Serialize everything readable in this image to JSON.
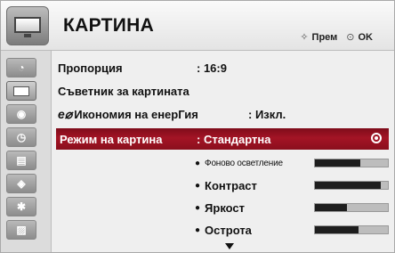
{
  "header": {
    "title": "КАРТИНА",
    "hint_move_icon": "dpad-icon",
    "hint_move": "Прем",
    "hint_ok_icon": "ok-circle-icon",
    "hint_ok": "OK"
  },
  "nav": {
    "items": [
      {
        "icon": "satellite-dish-icon",
        "glyph": "◔"
      },
      {
        "icon": "picture-icon",
        "glyph": ""
      },
      {
        "icon": "speaker-icon",
        "glyph": "◉"
      },
      {
        "icon": "clock-icon",
        "glyph": "◷"
      },
      {
        "icon": "lock-icon",
        "glyph": "▤"
      },
      {
        "icon": "options-icon",
        "glyph": "◈"
      },
      {
        "icon": "bluetooth-icon",
        "glyph": "✱"
      },
      {
        "icon": "clapper-icon",
        "glyph": "▨"
      }
    ],
    "active_index": 1
  },
  "menu": {
    "aspect_label": "Пропорция",
    "aspect_value": ": 16:9",
    "wizard_label": "Съветник за картината",
    "energy_icon": "eco-leaf-icon",
    "energy_label": "Икономия на енерГия",
    "energy_value": ": Изкл.",
    "mode_label": "Режим на картина",
    "mode_value": ": Стандартна"
  },
  "sub_settings": [
    {
      "name": "Фоново осветление",
      "value_fraction": 0.62,
      "small": true
    },
    {
      "name": "Контраст",
      "value_fraction": 0.9,
      "small": false
    },
    {
      "name": "Яркост",
      "value_fraction": 0.44,
      "small": false
    },
    {
      "name": "Острота",
      "value_fraction": 0.6,
      "small": false
    }
  ],
  "colors": {
    "selected_row": "#a41425",
    "bar_fill": "#1e1e1e",
    "bar_track": "#bdbdbd"
  }
}
